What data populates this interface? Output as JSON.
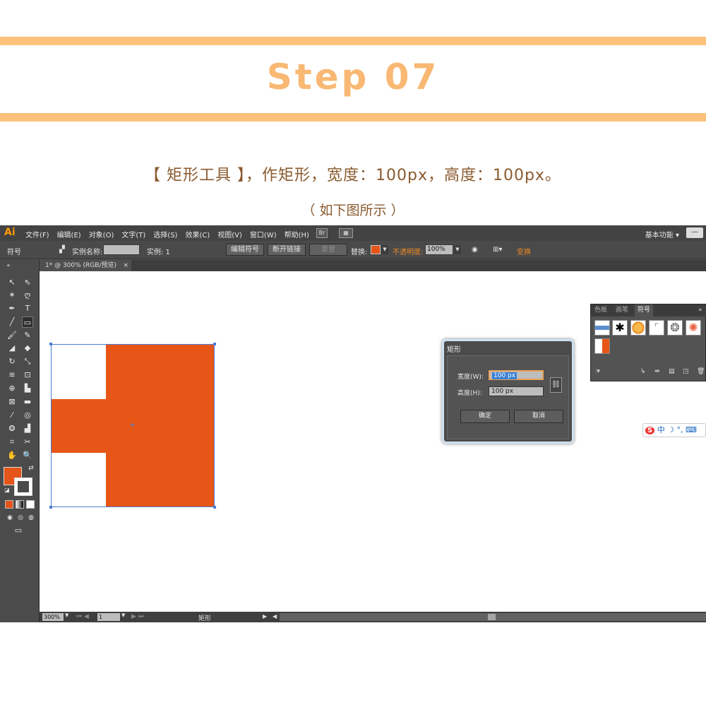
{
  "header": {
    "step_title": "Step 07",
    "instruction": "【 矩形工具 】，作矩形，宽度：100px，高度：100px。",
    "note": "（ 如下图所示 ）"
  },
  "app": {
    "logo": "Ai",
    "menu": [
      "文件(F)",
      "编辑(E)",
      "对象(O)",
      "文字(T)",
      "选择(S)",
      "效果(C)",
      "视图(V)",
      "窗口(W)",
      "帮助(H)"
    ],
    "bridge_icon": "Br",
    "workspace": "基本功能",
    "win_minimize": "—"
  },
  "control_bar": {
    "panel_name": "符号",
    "instance_name_label": "实例名称:",
    "instance_label": "实例: 1",
    "edit_symbol": "编辑符号",
    "break_link": "断开链接",
    "reset": "重置",
    "replace_label": "替换:",
    "opacity_label": "不透明度:",
    "opacity_value": "100%",
    "transform": "变换"
  },
  "document": {
    "tab_title": "1* @ 300% (RGB/预览)",
    "tab_close": "×"
  },
  "status_bar": {
    "zoom": "300%",
    "page": "1",
    "tool_name": "矩形"
  },
  "dialog": {
    "title": "矩形",
    "width_label": "宽度(W):",
    "width_value": "100 px",
    "height_label": "高度(H):",
    "height_value": "100 px",
    "ok": "确定",
    "cancel": "取消"
  },
  "symbols_panel": {
    "tabs": [
      "色板",
      "画笔",
      "符号"
    ],
    "active_tab": "符号"
  },
  "ime": {
    "logo": "S",
    "text": "中 ☽ °, ⌨"
  },
  "colors": {
    "accent_orange": "#e75617",
    "header_bar": "#fcc27b",
    "title_text": "#f9b873"
  }
}
